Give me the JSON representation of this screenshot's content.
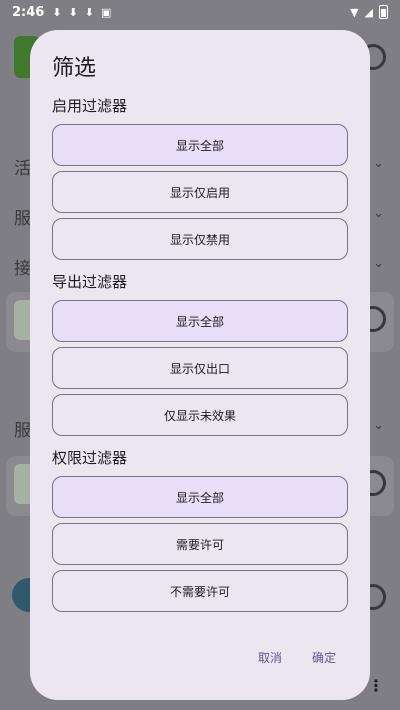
{
  "status_bar": {
    "time": "2:46",
    "notification_icons": [
      "download-icon",
      "download-icon",
      "download-icon",
      "a-icon"
    ]
  },
  "background": {
    "labels": [
      "活",
      "服",
      "接",
      "服"
    ]
  },
  "dialog": {
    "title": "筛选",
    "sections": [
      {
        "title": "启用过滤器",
        "options": [
          {
            "label": "显示全部",
            "selected": true
          },
          {
            "label": "显示仅启用",
            "selected": false
          },
          {
            "label": "显示仅禁用",
            "selected": false
          }
        ]
      },
      {
        "title": "导出过滤器",
        "options": [
          {
            "label": "显示全部",
            "selected": true
          },
          {
            "label": "显示仅出口",
            "selected": false
          },
          {
            "label": "仅显示未效果",
            "selected": false
          }
        ]
      },
      {
        "title": "权限过滤器",
        "options": [
          {
            "label": "显示全部",
            "selected": true
          },
          {
            "label": "需要许可",
            "selected": false
          },
          {
            "label": "不需要许可",
            "selected": false
          }
        ]
      }
    ],
    "cancel_label": "取消",
    "confirm_label": "确定"
  },
  "colors": {
    "dialog_bg": "#ece6f0",
    "selected_bg": "#e8def8",
    "accent": "#65558f",
    "scrim": "#7f7e84"
  }
}
